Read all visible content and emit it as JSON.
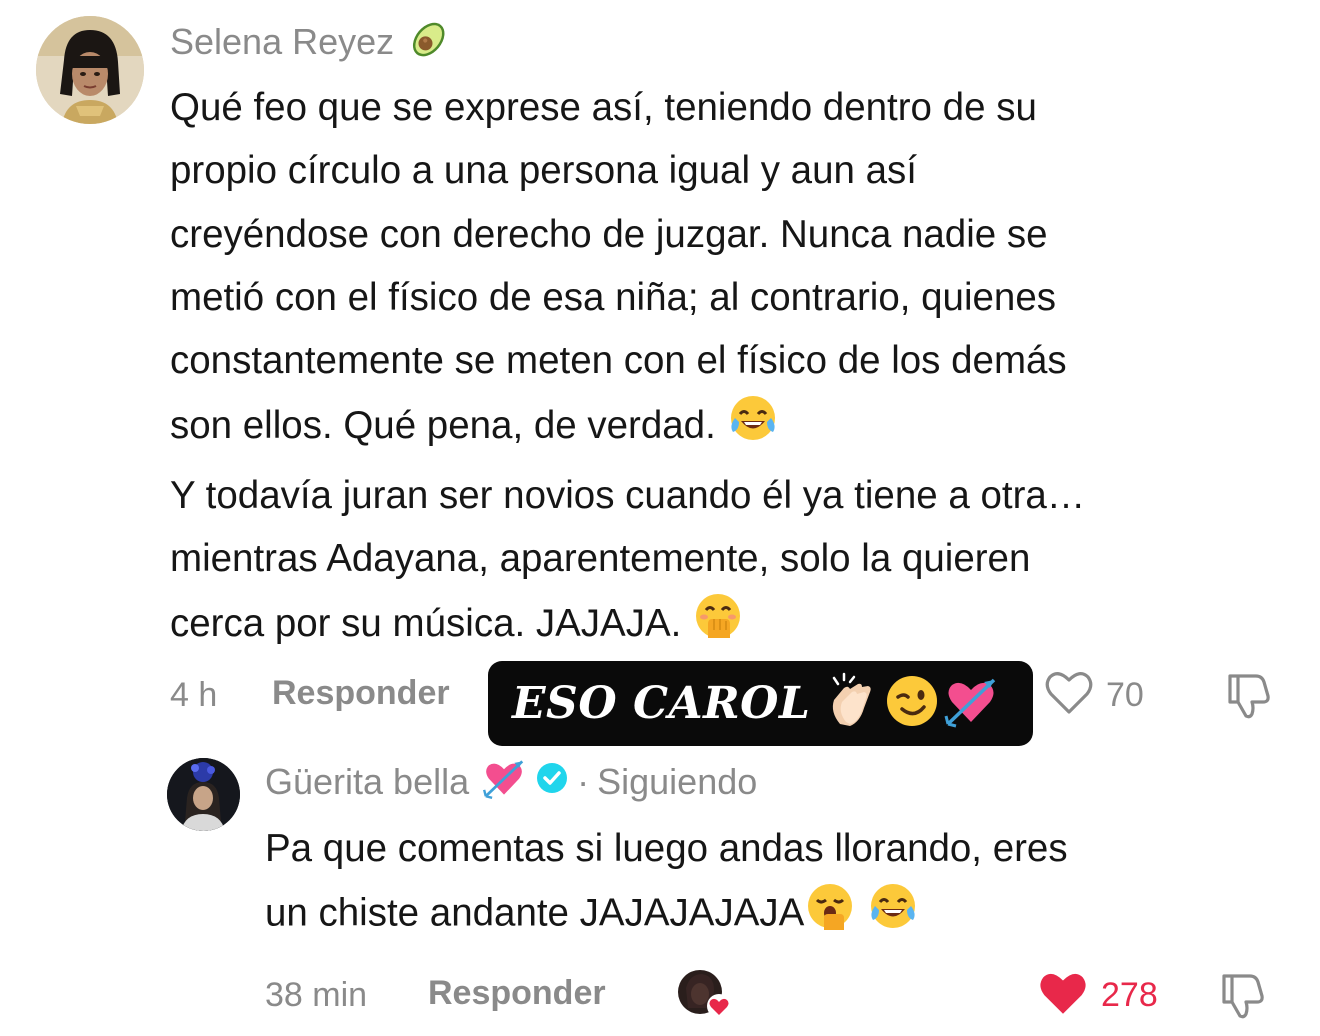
{
  "comment": {
    "username": "Selena Reyez",
    "username_icon": "avocado-icon",
    "text_lines": [
      "Qué feo que se exprese así, teniendo dentro de su",
      "propio círculo a una persona igual y aun así",
      "creyéndose con derecho de juzgar. Nunca nadie se",
      "metió con el físico de esa niña; al contrario, quienes",
      "constantemente se meten con el físico de los demás",
      "son ellos. Qué pena, de verdad.",
      "Y todavía juran ser novios cuando él ya tiene a otra…",
      "mientras Adayana, aparentemente, solo la quieren",
      "cerca por su música. JAJAJA."
    ],
    "timestamp": "4 h",
    "reply_label": "Responder",
    "like_count": "70",
    "liked": false
  },
  "sticker": {
    "text": "ESO CAROL",
    "emojis": [
      "clapping-hands-icon",
      "winking-face-icon",
      "heart-with-arrow-icon"
    ]
  },
  "reply": {
    "username": "Güerita bella",
    "verified": true,
    "follow_status": "Siguiendo",
    "text_lines": [
      "Pa que comentas si luego andas llorando, eres",
      "un chiste andante JAJAJAJAJA"
    ],
    "timestamp": "38 min",
    "reply_label": "Responder",
    "like_count": "278",
    "liked": true
  },
  "colors": {
    "text": "#161616",
    "muted": "#8a8a8a",
    "like_red": "#e8284a",
    "verified_blue": "#20d5ec"
  }
}
